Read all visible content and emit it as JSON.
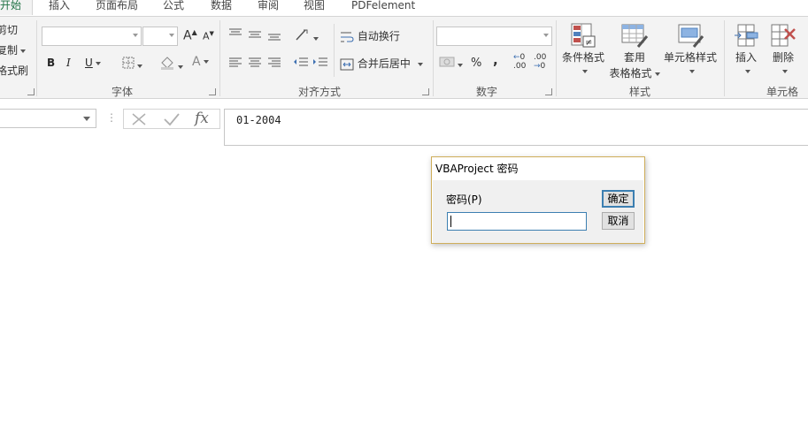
{
  "tabs": [
    {
      "label": "开始",
      "active": true
    },
    {
      "label": "插入"
    },
    {
      "label": "页面布局"
    },
    {
      "label": "公式"
    },
    {
      "label": "数据"
    },
    {
      "label": "审阅"
    },
    {
      "label": "视图"
    },
    {
      "label": "PDFelement"
    }
  ],
  "clipboard": {
    "cut": "剪切",
    "copy": "复制",
    "format_painter": "格式刷"
  },
  "font": {
    "group_label": "字体",
    "bold": "B",
    "italic": "I",
    "underline": "U",
    "grow": "A",
    "shrink": "A",
    "font_color": "A"
  },
  "alignment": {
    "group_label": "对齐方式",
    "wrap_text": "自动换行",
    "merge_center": "合并后居中"
  },
  "number": {
    "group_label": "数字",
    "percent": "%",
    "comma": ",",
    "inc_decimal": ".00",
    "dec_decimal": ".00"
  },
  "styles": {
    "group_label": "样式",
    "conditional": "条件格式",
    "table_line1": "套用",
    "table_line2": "表格格式",
    "cell_styles": "单元格样式"
  },
  "cells": {
    "group_label": "单元格",
    "insert": "插入",
    "delete": "删除"
  },
  "formula_bar": {
    "fx": "fx",
    "value": "01-2004"
  },
  "dialog": {
    "title": "VBAProject 密码",
    "password_label": "密码(P)",
    "password_value": "",
    "ok": "确定",
    "cancel": "取消"
  },
  "colors": {
    "excel_green": "#217346",
    "dialog_border": "#cfae5a",
    "focus_blue": "#3c7fb1"
  }
}
